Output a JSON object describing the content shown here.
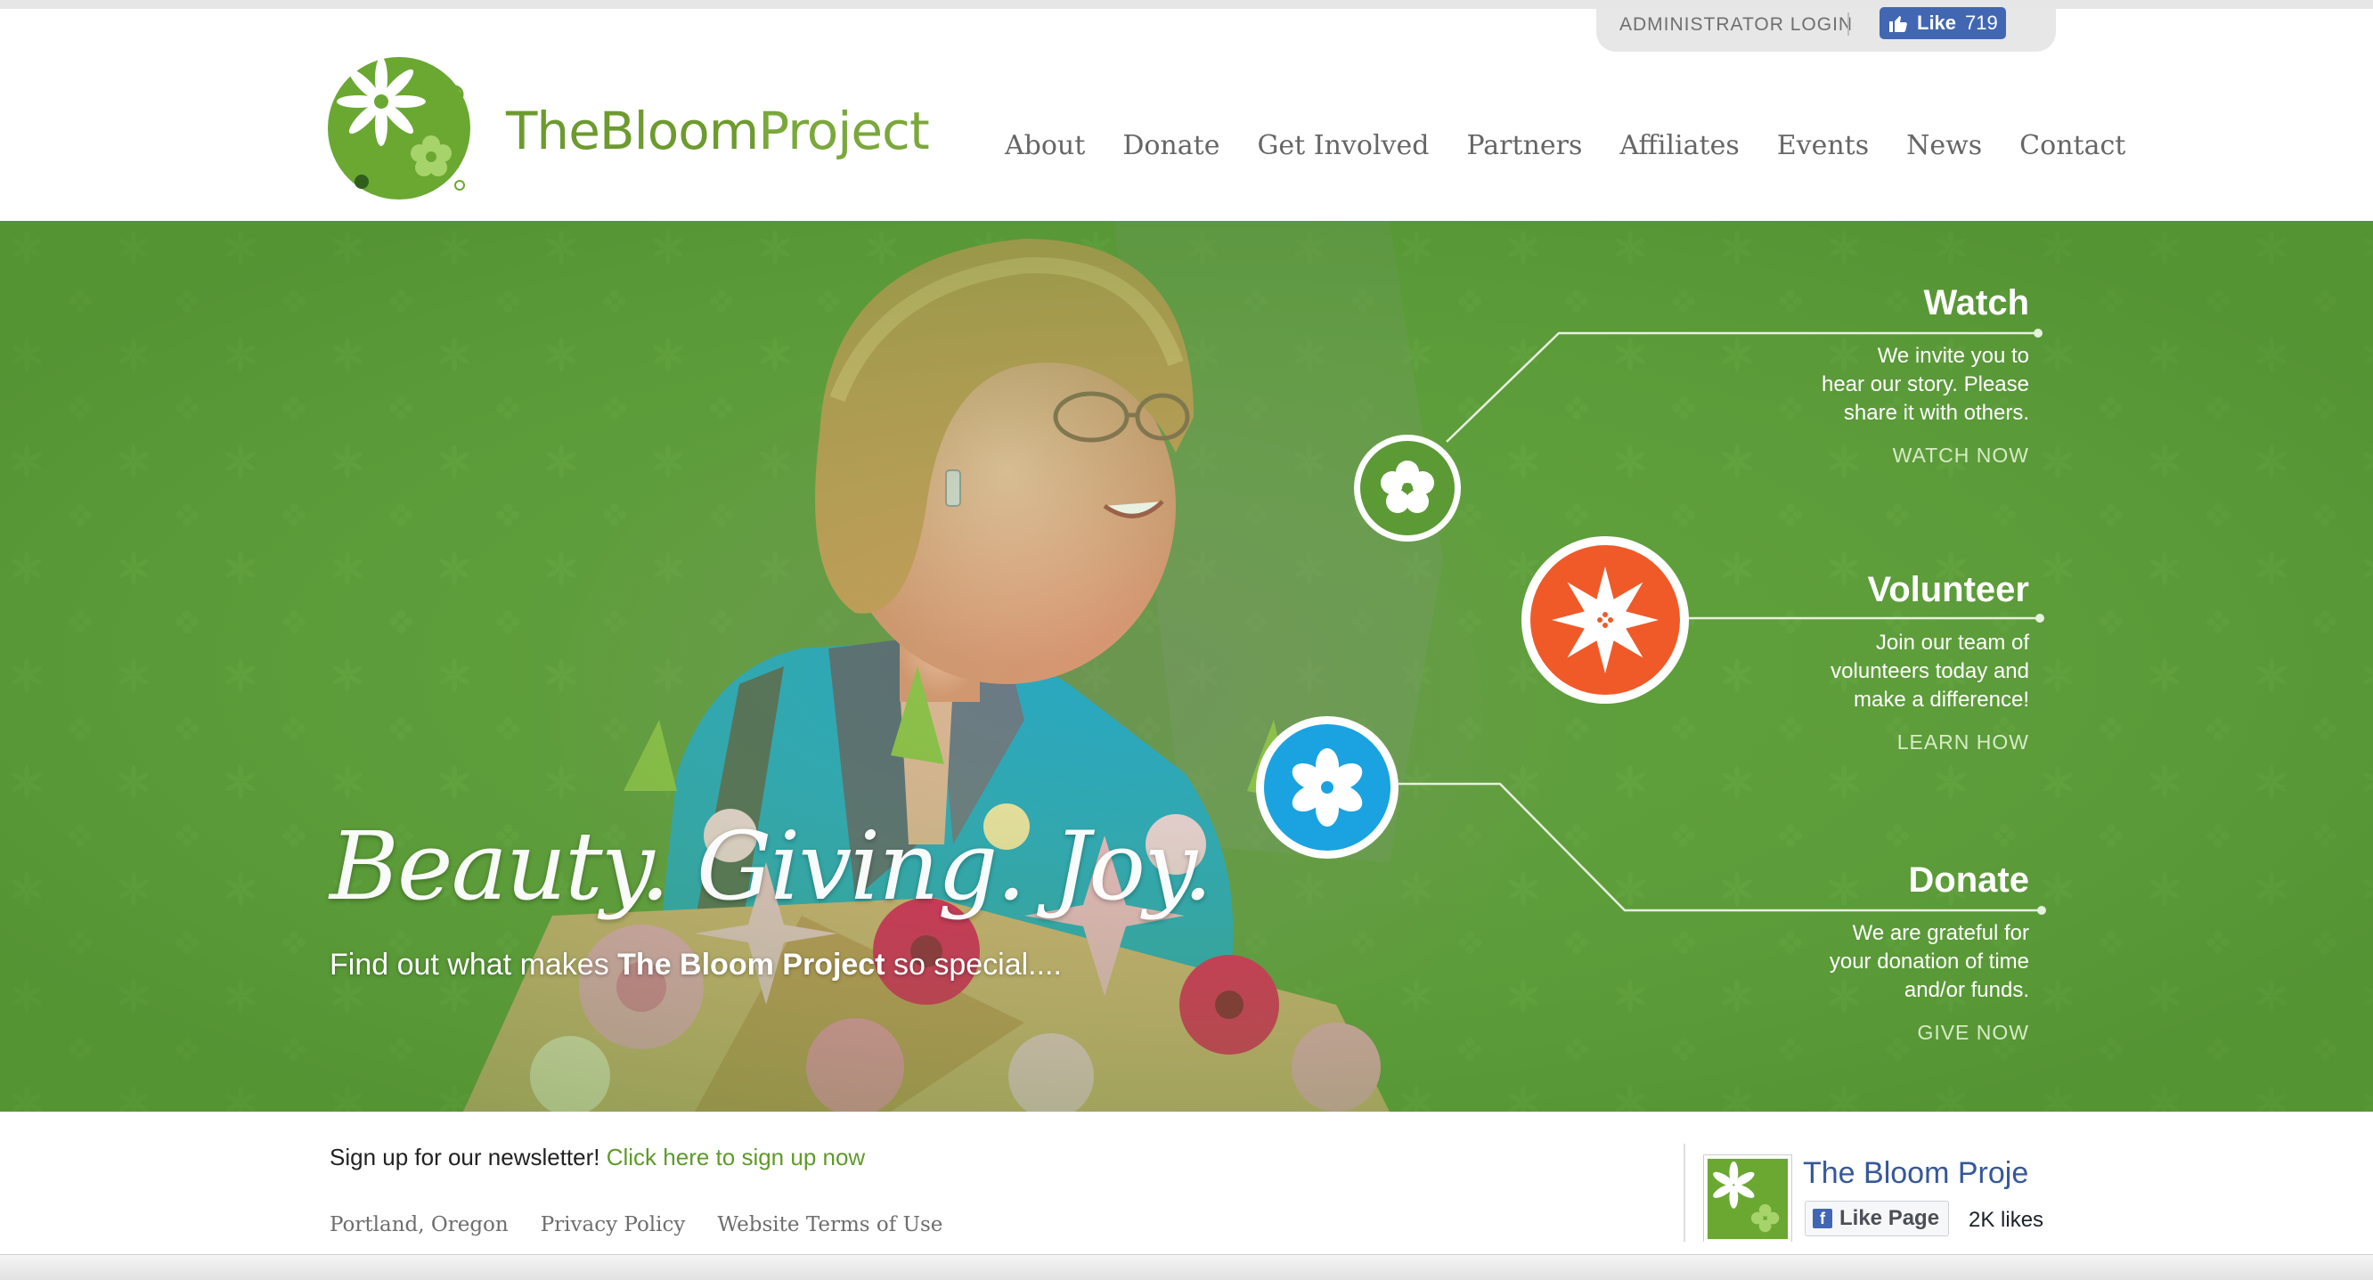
{
  "header": {
    "admin_login": "ADMINISTRATOR LOGIN",
    "fb_like_label": "Like",
    "fb_like_count": "719",
    "brand": {
      "the": "The",
      "bloom": "Bloom",
      "project": "Project"
    }
  },
  "nav": {
    "items": [
      "About",
      "Donate",
      "Get Involved",
      "Partners",
      "Affiliates",
      "Events",
      "News",
      "Contact"
    ]
  },
  "hero": {
    "tagline": "Beauty. Giving. Joy.",
    "subtag_prefix": "Find out what makes ",
    "subtag_bold": "The Bloom Project",
    "subtag_suffix": " so special....",
    "panels": [
      {
        "title": "Watch",
        "lines": [
          "We invite you to",
          "hear our story. Please",
          "share it with others."
        ],
        "link": "WATCH NOW",
        "icon": "flower-green-icon",
        "color": "#5c9a35"
      },
      {
        "title": "Volunteer",
        "lines": [
          "Join our team of",
          "volunteers today and",
          "make a difference!"
        ],
        "link": "LEARN HOW",
        "icon": "flower-orange-icon",
        "color": "#f05a28"
      },
      {
        "title": "Donate",
        "lines": [
          "We are grateful for",
          "your donation of time",
          "and/or funds."
        ],
        "link": "GIVE NOW",
        "icon": "flower-blue-icon",
        "color": "#1aa3e0"
      }
    ]
  },
  "footer": {
    "newsletter_text": "Sign up for our newsletter! ",
    "newsletter_link": "Click here to sign up now",
    "links": [
      "Portland, Oregon",
      "Privacy Policy",
      "Website Terms of Use"
    ],
    "fb_page_name": "The Bloom Proje",
    "fb_like_page": "Like Page",
    "fb_likes": "2K likes"
  },
  "colors": {
    "brand_green": "#6d9b2e",
    "hero_green": "#5d9d3a",
    "orange": "#f05a28",
    "blue": "#1aa3e0",
    "fb_blue": "#4267b2"
  }
}
